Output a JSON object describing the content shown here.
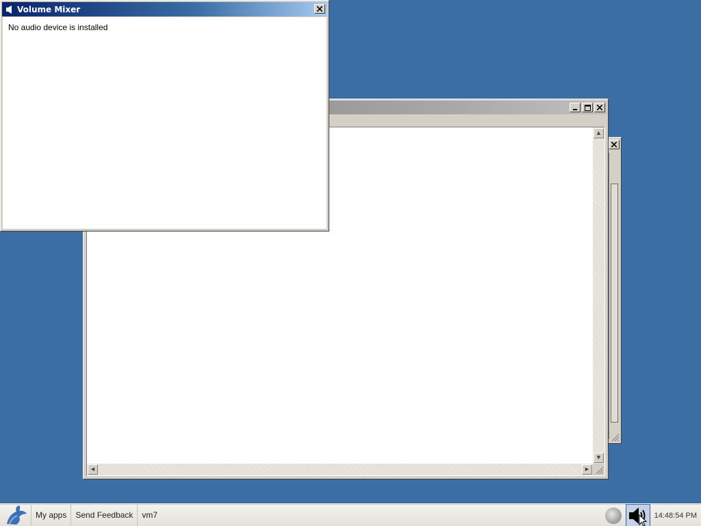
{
  "mixer": {
    "title": "Volume Mixer",
    "message": "No audio device is installed"
  },
  "taskbar": {
    "items": [
      {
        "label": "My apps"
      },
      {
        "label": "Send Feedback"
      },
      {
        "label": "vm7"
      }
    ],
    "clock": "14:48:54 PM"
  },
  "colors": {
    "desktop": "#3a6ea5",
    "active_title": "#0a246a",
    "inactive_title": "#808080"
  }
}
